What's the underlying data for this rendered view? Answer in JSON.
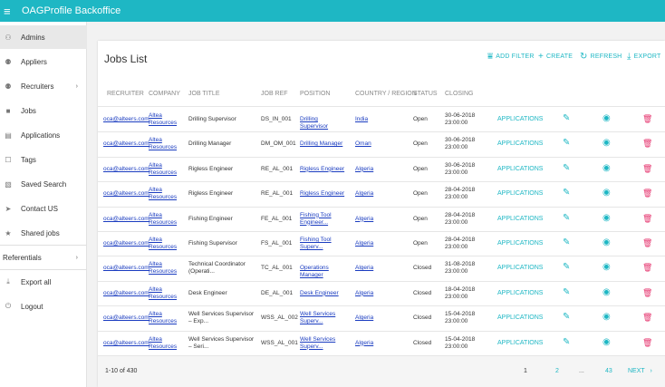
{
  "app": {
    "title": "OAGProfile Backoffice",
    "menu_icon": "hamburger-icon"
  },
  "sidebar": [
    {
      "label": "Admins",
      "icon": "user-icon",
      "glyph": "⚇",
      "active": true
    },
    {
      "label": "Appliers",
      "icon": "people-icon",
      "glyph": "⚉"
    },
    {
      "label": "Recruiters",
      "icon": "people-icon",
      "glyph": "⚉",
      "arrow": true
    },
    {
      "label": "Jobs",
      "icon": "briefcase-icon",
      "glyph": "■"
    },
    {
      "label": "Applications",
      "icon": "document-icon",
      "glyph": "▤"
    },
    {
      "label": "Tags",
      "icon": "tag-icon",
      "glyph": "☐"
    },
    {
      "label": "Saved Search",
      "icon": "search-doc-icon",
      "glyph": "▧"
    },
    {
      "label": "Contact US",
      "icon": "send-icon",
      "glyph": "➤"
    },
    {
      "label": "Shared jobs",
      "icon": "star-icon",
      "glyph": "★"
    },
    {
      "label": "Referentials",
      "icon": "",
      "glyph": "",
      "arrow": true,
      "top_level": true
    },
    {
      "label": "Export all",
      "icon": "download-icon",
      "glyph": "⤓"
    },
    {
      "label": "Logout",
      "icon": "power-icon",
      "glyph": "⏻"
    }
  ],
  "jobs": {
    "title": "Jobs List",
    "toolbar": {
      "add_filter": "ADD FILTER",
      "create": "CREATE",
      "refresh": "REFRESH",
      "export": "EXPORT"
    },
    "columns": [
      "RECRUITER",
      "COMPANY",
      "JOB TITLE",
      "JOB REF",
      "POSITION",
      "COUNTRY / REGION",
      "STATUS",
      "CLOSING"
    ],
    "rows": [
      {
        "recruiter": "oca@alteers.com",
        "company": "Altea Resources",
        "title": "Drilling Supervisor",
        "ref": "DS_IN_001",
        "position": "Drilling Supervisor",
        "country": "India",
        "status": "Open",
        "closing_date": "30-06-2018",
        "closing_time": "23:00:00",
        "apps": "APPLICATIONS"
      },
      {
        "recruiter": "oca@alteers.com",
        "company": "Altea Resources",
        "title": "Drilling Manager",
        "ref": "DM_OM_001",
        "position": "Drilling Manager",
        "country": "Oman",
        "status": "Open",
        "closing_date": "30-06-2018",
        "closing_time": "23:00:00",
        "apps": "APPLICATIONS"
      },
      {
        "recruiter": "oca@alteers.com",
        "company": "Altea Resources",
        "title": "Rigless Engineer",
        "ref": "RE_AL_001",
        "position": "Rigless Engineer",
        "country": "Algeria",
        "status": "Open",
        "closing_date": "30-06-2018",
        "closing_time": "23:00:00",
        "apps": "APPLICATIONS"
      },
      {
        "recruiter": "oca@alteers.com",
        "company": "Altea Resources",
        "title": "Rigless Engineer",
        "ref": "RE_AL_001",
        "position": "Rigless Engineer",
        "country": "Algeria",
        "status": "Open",
        "closing_date": "28-04-2018",
        "closing_time": "23:00:00",
        "apps": "APPLICATIONS"
      },
      {
        "recruiter": "oca@alteers.com",
        "company": "Altea Resources",
        "title": "Fishing Engineer",
        "ref": "FE_AL_001",
        "position": "Fishing Tool Engineer...",
        "country": "Algeria",
        "status": "Open",
        "closing_date": "28-04-2018",
        "closing_time": "23:00:00",
        "apps": "APPLICATIONS"
      },
      {
        "recruiter": "oca@alteers.com",
        "company": "Altea Resources",
        "title": "Fishing Supervisor",
        "ref": "FS_AL_001",
        "position": "Fishing Tool Superv...",
        "country": "Algeria",
        "status": "Open",
        "closing_date": "28-04-2018",
        "closing_time": "23:00:00",
        "apps": "APPLICATIONS"
      },
      {
        "recruiter": "oca@alteers.com",
        "company": "Altea Resources",
        "title": "Technical Coordinator (Operati...",
        "ref": "TC_AL_001",
        "position": "Operations Manager",
        "country": "Algeria",
        "status": "Closed",
        "closing_date": "31-08-2018",
        "closing_time": "23:00:00",
        "apps": "APPLICATIONS"
      },
      {
        "recruiter": "oca@alteers.com",
        "company": "Altea Resources",
        "title": "Desk Engineer",
        "ref": "DE_AL_001",
        "position": "Desk Engineer",
        "country": "Algeria",
        "status": "Closed",
        "closing_date": "18-04-2018",
        "closing_time": "23:00:00",
        "apps": "APPLICATIONS"
      },
      {
        "recruiter": "oca@alteers.com",
        "company": "Altea Resources",
        "title": "Well Services Supervisor – Exp...",
        "ref": "WSS_AL_002",
        "position": "Well Services Superv...",
        "country": "Algeria",
        "status": "Closed",
        "closing_date": "15-04-2018",
        "closing_time": "23:00:00",
        "apps": "APPLICATIONS"
      },
      {
        "recruiter": "oca@alteers.com",
        "company": "Altea Resources",
        "title": "Well Services Supervisor – Seri...",
        "ref": "WSS_AL_001",
        "position": "Well Services Superv...",
        "country": "Algeria",
        "status": "Closed",
        "closing_date": "15-04-2018",
        "closing_time": "23:00:00",
        "apps": "APPLICATIONS"
      }
    ],
    "pagination": {
      "range": "1-10 of 430",
      "pages": [
        "1",
        "2",
        "...",
        "43"
      ],
      "next": "NEXT"
    }
  },
  "colors": {
    "accent": "#1eb7c4",
    "delete": "#e5336d",
    "link": "#1a3cc0"
  }
}
